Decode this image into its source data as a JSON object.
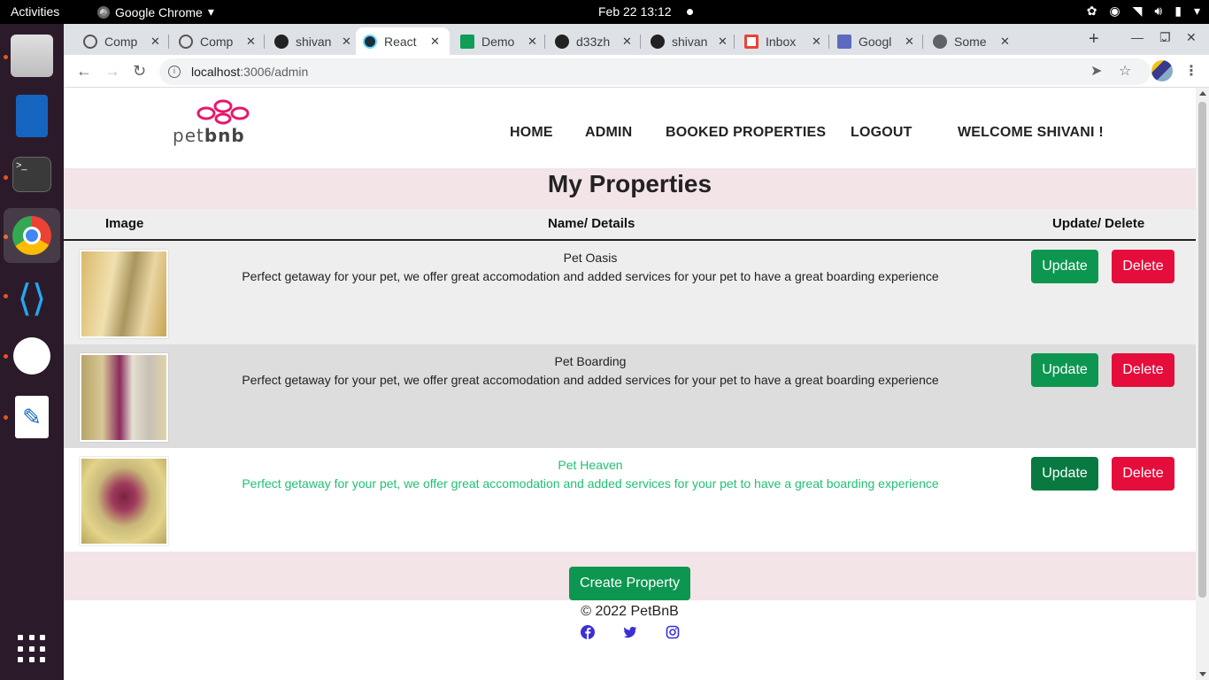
{
  "system": {
    "activities": "Activities",
    "app_name": "Google Chrome",
    "clock": "Feb 22  13:12"
  },
  "browser": {
    "tabs": [
      {
        "title": "Comp",
        "icon": "globe-plus-icon"
      },
      {
        "title": "Comp",
        "icon": "globe-plus-icon"
      },
      {
        "title": "shivan",
        "icon": "github-icon"
      },
      {
        "title": "React",
        "icon": "react-icon",
        "active": true
      },
      {
        "title": "Demo",
        "icon": "sheets-icon"
      },
      {
        "title": "d33zh",
        "icon": "github-icon"
      },
      {
        "title": "shivan",
        "icon": "github-icon"
      },
      {
        "title": "Inbox",
        "icon": "gmail-icon"
      },
      {
        "title": "Googl",
        "icon": "google-forms-icon"
      },
      {
        "title": "Some",
        "icon": "globe-icon"
      }
    ],
    "url_host": "localhost",
    "url_path": ":3006/admin"
  },
  "header": {
    "logo_text_1": "pet",
    "logo_text_2": "bnb",
    "nav": {
      "home": "HOME",
      "admin": "ADMIN",
      "booked": "BOOKED PROPERTIES",
      "logout": "LOGOUT",
      "welcome": "WELCOME SHIVANI !"
    }
  },
  "main": {
    "title": "My Properties",
    "columns": {
      "image": "Image",
      "details": "Name/ Details",
      "actions": "Update/ Delete"
    },
    "rows": [
      {
        "name": "Pet Oasis",
        "description": "Perfect getaway for your pet, we offer great accomodation and added services for your pet to have a great boarding experience"
      },
      {
        "name": "Pet Boarding",
        "description": "Perfect getaway for your pet, we offer great accomodation and added services for your pet to have a great boarding experience"
      },
      {
        "name": "Pet Heaven",
        "description": "Perfect getaway for your pet, we offer great accomodation and added services for your pet to have a great boarding experience"
      }
    ],
    "update_label": "Update",
    "delete_label": "Delete",
    "create_label": "Create Property"
  },
  "footer": {
    "copyright": "© 2022 PetBnB"
  },
  "colors": {
    "accent_green": "#0d9650",
    "delete_red": "#e50d3c",
    "highlight_text": "#20c073",
    "section_bg": "#f3e4e8",
    "social_blue": "#3d2fd6"
  }
}
